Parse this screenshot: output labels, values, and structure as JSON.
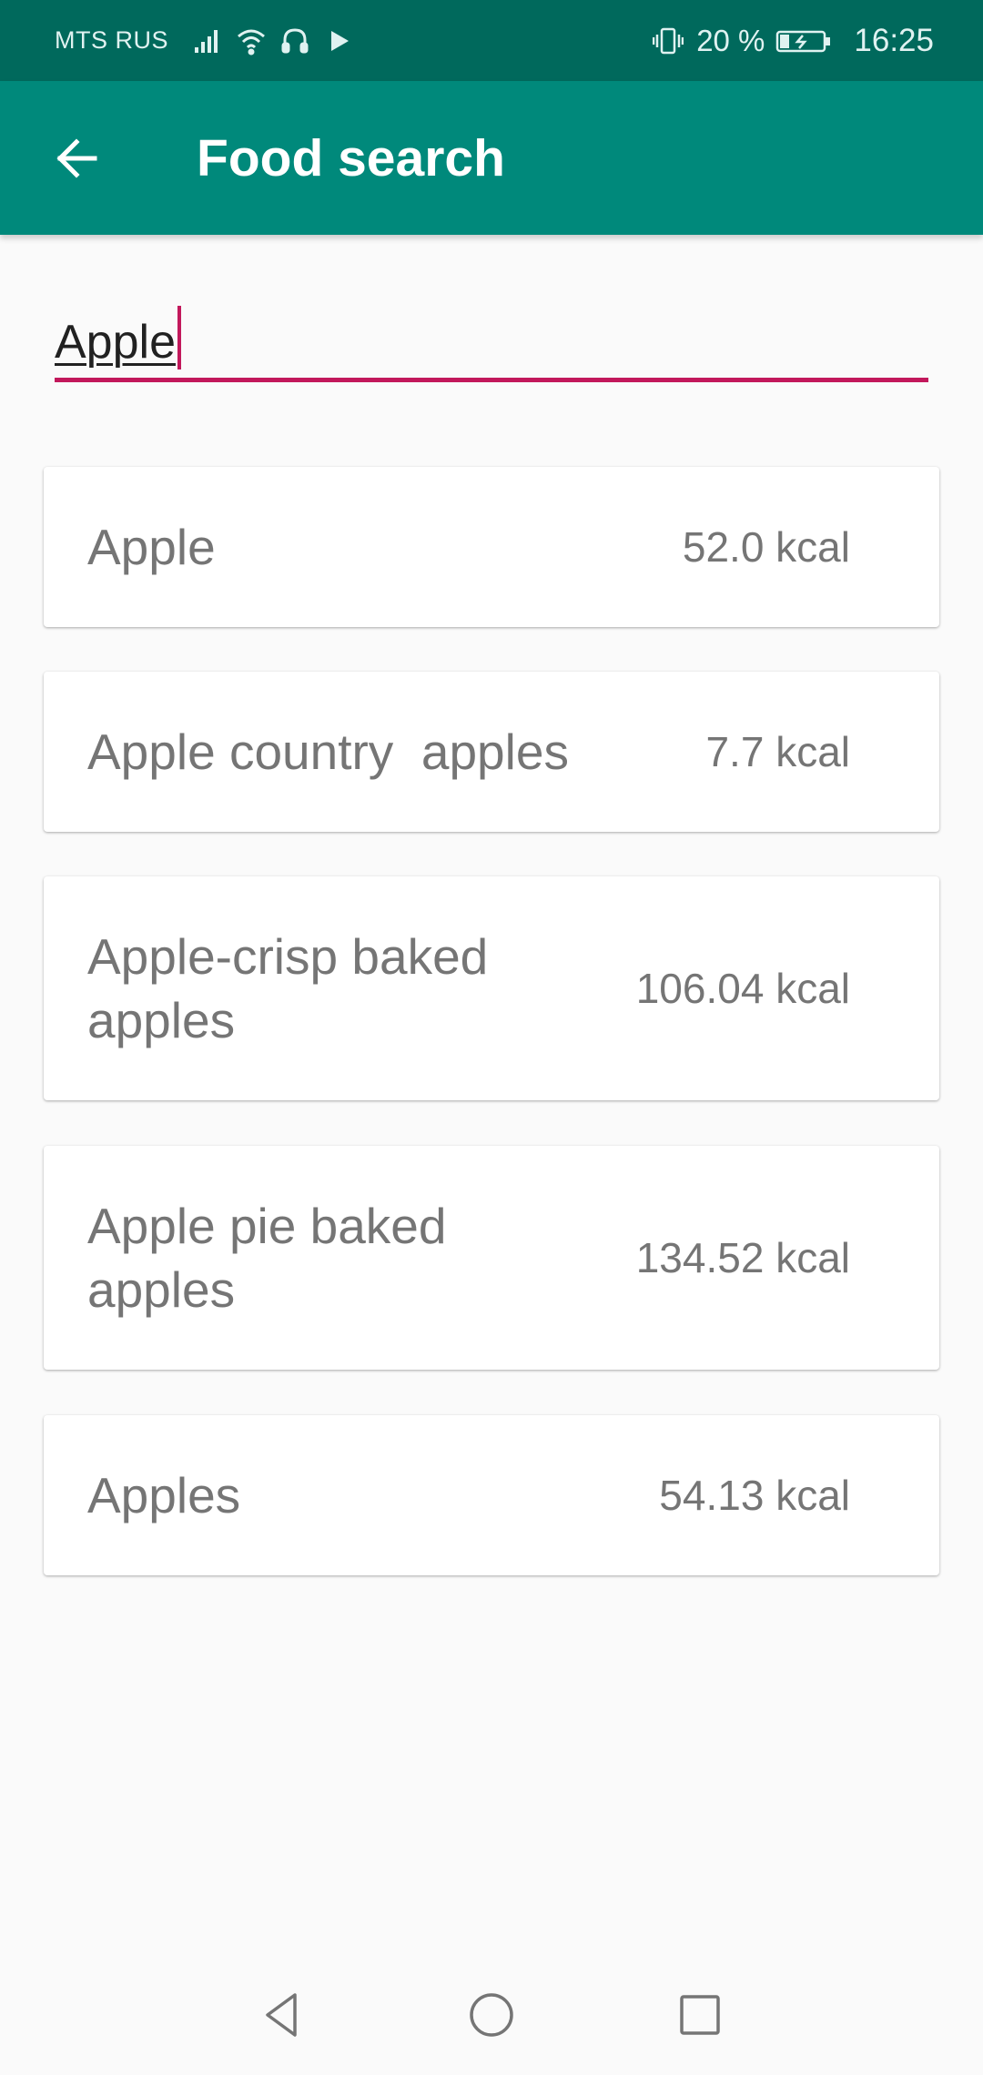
{
  "status_bar": {
    "carrier": "MTS RUS",
    "battery_percent": "20 %",
    "time": "16:25",
    "icons": [
      "signal-icon",
      "wifi-icon",
      "headset-icon",
      "play-icon",
      "vibrate-icon",
      "battery-charging-icon"
    ]
  },
  "app_bar": {
    "title": "Food search",
    "back_icon": "arrow-back-icon"
  },
  "search": {
    "value": "Apple"
  },
  "results": [
    {
      "name": "Apple",
      "kcal": "52.0 kcal"
    },
    {
      "name": "Apple country  apples",
      "kcal": "7.7 kcal"
    },
    {
      "name": "Apple-crisp baked apples",
      "kcal": "106.04 kcal"
    },
    {
      "name": "Apple pie baked apples",
      "kcal": "134.52 kcal"
    },
    {
      "name": "Apples",
      "kcal": "54.13 kcal"
    }
  ],
  "nav_bar": {
    "icons": [
      "nav-back-icon",
      "nav-home-icon",
      "nav-recents-icon"
    ]
  },
  "colors": {
    "status_bar": "#00695c",
    "app_bar": "#00897b",
    "accent": "#c2185b",
    "background": "#fafafa"
  }
}
